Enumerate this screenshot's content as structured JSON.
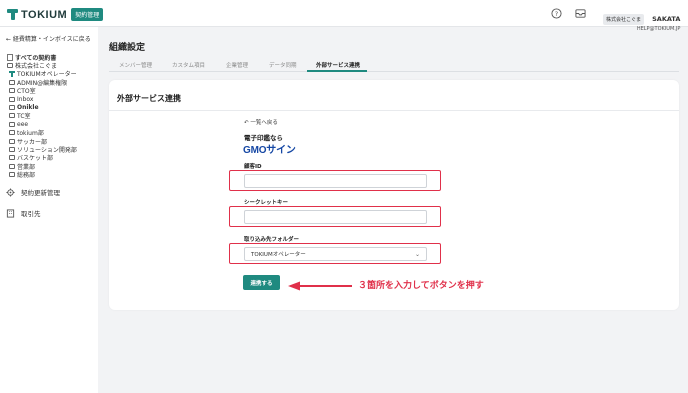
{
  "header": {
    "logo_text": "TOKIUM",
    "logo_badge": "契約管理",
    "company": "株式会社こぐま",
    "username": "SAKATA",
    "email": "HELP@TOKIUM.JP"
  },
  "sidebar": {
    "back_link": "← 経費精算・インボイスに戻る",
    "tree": [
      "すべての契約書",
      "株式会社こぐま",
      "TOKIUMオペレーター",
      "ADMIN@編集権限",
      "CTO室",
      "Inbox",
      "Onikle",
      "TC室",
      "eee",
      "tokium部",
      "サッカー部",
      "ソリューション開発部",
      "バスケット部",
      "営業部",
      "総務部"
    ],
    "nav": [
      "契約更新管理",
      "取引先"
    ]
  },
  "main": {
    "page_title": "組織設定",
    "tabs": [
      "メンバー管理",
      "カスタム項目",
      "企業管理",
      "データ同期",
      "外部サービス連携"
    ],
    "card_title": "外部サービス連携",
    "back_list": "一覧へ戻る",
    "service_desc": "電子印鑑なら",
    "service_logo": "GMOサイン",
    "fields": {
      "customer_id_label": "顧客ID",
      "customer_id_value": "",
      "secret_key_label": "シークレットキー",
      "secret_key_value": "",
      "folder_label": "取り込み先フォルダー",
      "folder_value": "TOKIUMオペレーター"
    },
    "submit_label": "連携する"
  },
  "annotation": {
    "text": "３箇所を入力してボタンを押す",
    "color": "#e0304a"
  },
  "colors": {
    "accent": "#1f8a80",
    "highlight": "#e0304a",
    "gmo_blue": "#1547a4"
  }
}
